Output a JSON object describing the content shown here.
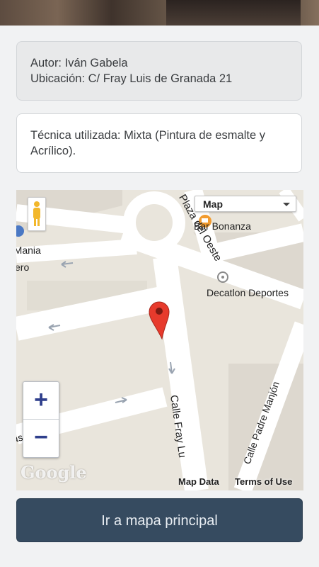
{
  "author": "Autor: Iván Gabela",
  "location": "Ubicación: C/ Fray Luis de Granada 21",
  "technique": "Técnica utilizada: Mixta (Pintura de esmalte y Acrílico).",
  "map": {
    "type_selector": "Map",
    "labels": {
      "plaza": "Plaza del Oeste",
      "bar": "Bar Bonanza",
      "decathlon": "Decatlon Deportes",
      "mania": "rMania",
      "ero": "ero",
      "fray": "Calle Fray Lu",
      "padre": "Calle Padre Manjón",
      "rias": "rias"
    },
    "zoom_in": "+",
    "zoom_out": "−",
    "logo": "Google",
    "map_data": "Map Data",
    "terms": "Terms of Use"
  },
  "button_label": "Ir a mapa principal"
}
